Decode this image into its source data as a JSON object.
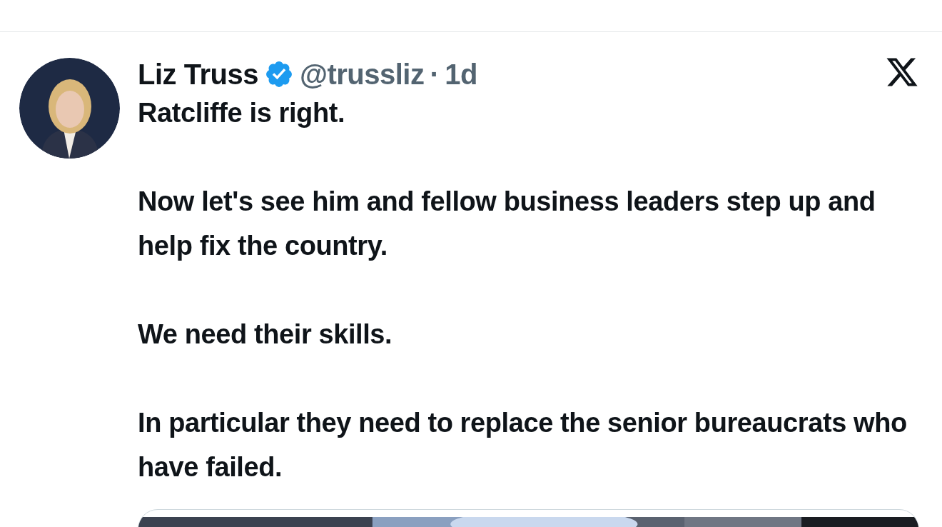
{
  "tweet": {
    "author": {
      "name": "Liz Truss",
      "verified": true,
      "handle": "@trussliz",
      "separator": "·",
      "time": "1d"
    },
    "paragraphs": [
      "Ratcliffe is right.",
      "Now let's see him and fellow business leaders step up and help fix the country.",
      "We need their skills.",
      "In particular they need to replace the senior bureaucrats who have failed."
    ]
  }
}
